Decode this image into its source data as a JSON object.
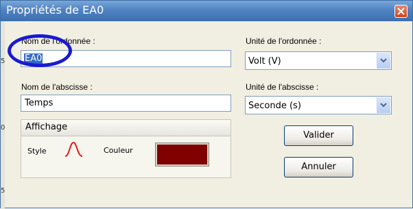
{
  "window": {
    "title": "Propriétés de EA0",
    "close_icon": "close-icon",
    "accent_color": "#3d6fb0",
    "close_color": "#c8451f"
  },
  "form": {
    "ordinate_name_label": "Nom de l'ordonnée :",
    "ordinate_name_value": "EA0",
    "abscissa_name_label": "Nom de l'abscisse :",
    "abscissa_name_value": "Temps",
    "ordinate_unit_label": "Unité de l'ordonnée :",
    "ordinate_unit_value": "Volt (V)",
    "abscissa_unit_label": "Unité de l'abscisse :",
    "abscissa_unit_value": "Seconde (s)"
  },
  "display": {
    "title": "Affichage",
    "style_label": "Style",
    "style_icon": "curve-style-icon",
    "color_label": "Couleur",
    "color_value": "#800000"
  },
  "buttons": {
    "validate": "Valider",
    "cancel": "Annuler"
  },
  "annotation": {
    "circle_color": "#1a1ad0"
  }
}
